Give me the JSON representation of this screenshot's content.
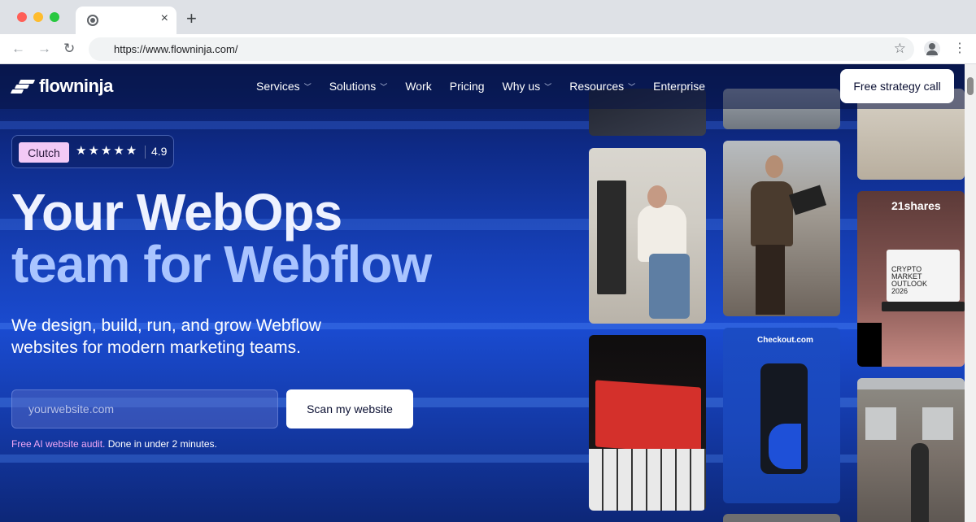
{
  "browser": {
    "tab_close": "×",
    "new_tab": "+",
    "back": "←",
    "forward": "→",
    "reload": "↻",
    "url": "https://www.flowninja.com/",
    "bookmark": "☆",
    "menu": "⋮"
  },
  "site": {
    "logo_text": "flowninja",
    "nav": [
      {
        "label": "Services"
      },
      {
        "label": "Solutions"
      },
      {
        "label": "Work"
      },
      {
        "label": "Pricing"
      },
      {
        "label": "Why us"
      },
      {
        "label": "Resources"
      },
      {
        "label": "Enterprise"
      }
    ],
    "cta": "Free strategy call"
  },
  "hero": {
    "clutch_label": "Clutch",
    "stars": "★★★★★",
    "rating": "4.9",
    "headline_line1": "Your WebOps",
    "headline_line2": "team for Webflow",
    "subhead": "We design, build, run, and grow Webflow websites for modern marketing teams.",
    "input_placeholder": "yourwebsite.com",
    "scan_button": "Scan my website",
    "audit_highlight": "Free AI website audit.",
    "audit_rest": " Done in under 2 minutes."
  },
  "tiles": {
    "shares_label": "21shares",
    "shares_caption": "CRYPTO MARKET OUTLOOK 2026",
    "checkout_label": "Checkout.com"
  },
  "colors": {
    "accent_pink": "#f2a8f5",
    "clutch_pill": "#f2c9f6",
    "hero_blue": "#1a4bd0"
  }
}
